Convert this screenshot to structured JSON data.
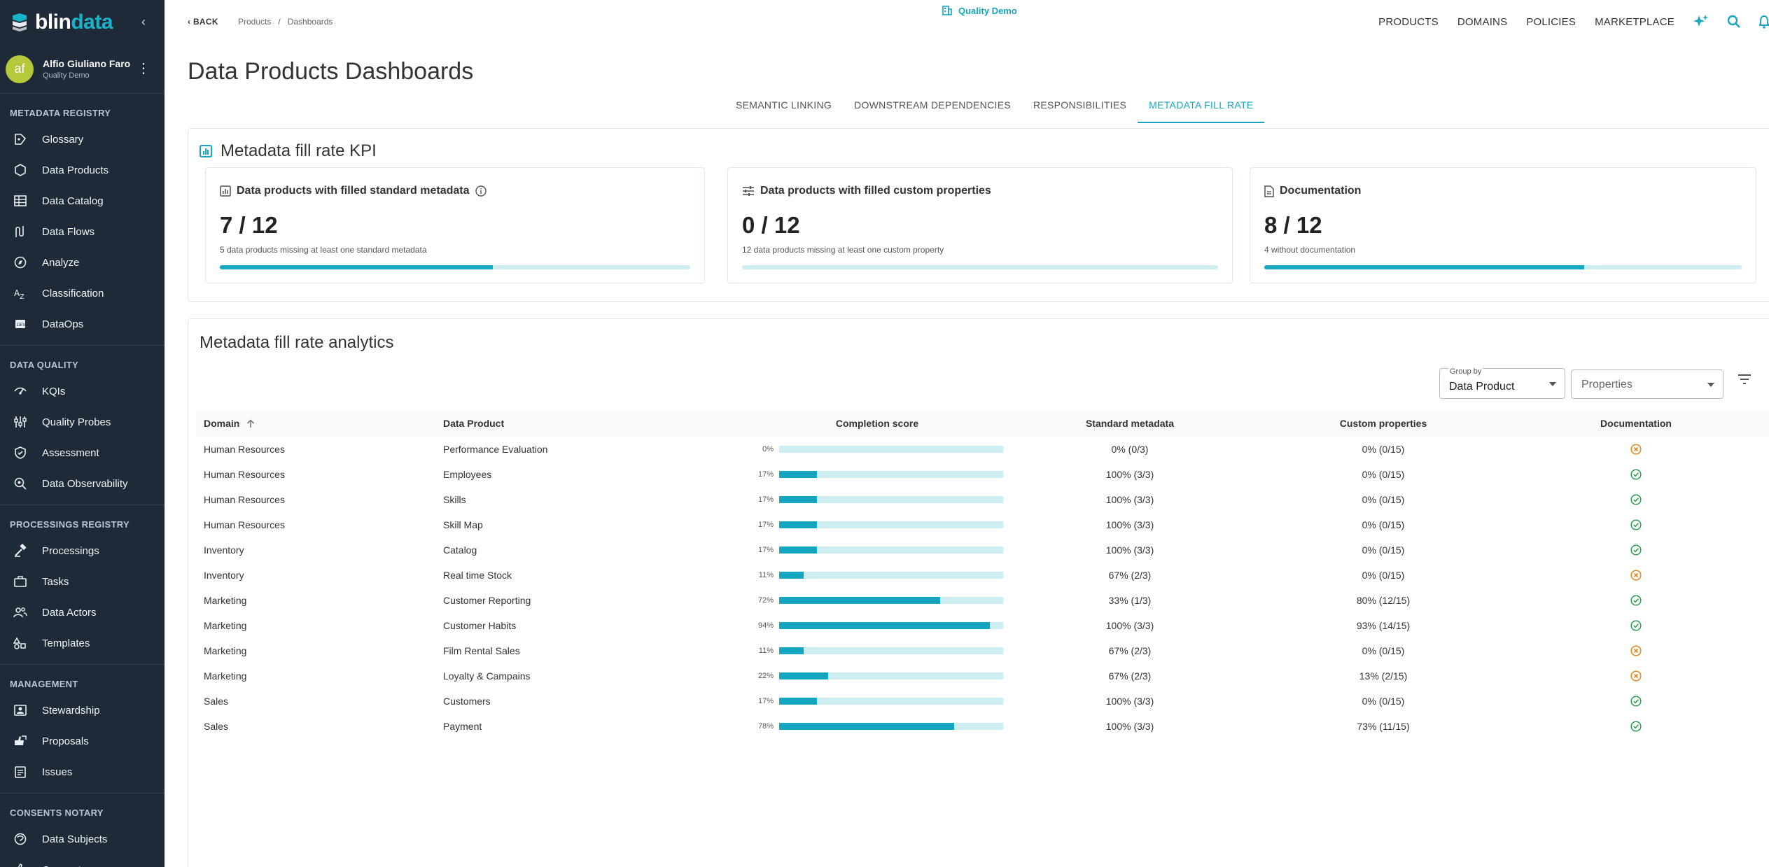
{
  "brand": {
    "logo_text_a": "blin",
    "logo_text_b": "data",
    "accent": "#18a5bd",
    "sidebar_bg": "#1e2a37"
  },
  "user": {
    "initials": "af",
    "name": "Alfio Giuliano Faro",
    "tenant": "Quality Demo"
  },
  "sidebar": {
    "sections": [
      {
        "title": "METADATA REGISTRY",
        "items": [
          {
            "label": "Glossary",
            "icon": "glossary-icon"
          },
          {
            "label": "Data Products",
            "icon": "data-products-icon"
          },
          {
            "label": "Data Catalog",
            "icon": "data-catalog-icon"
          },
          {
            "label": "Data Flows",
            "icon": "data-flows-icon"
          },
          {
            "label": "Analyze",
            "icon": "analyze-icon"
          },
          {
            "label": "Classification",
            "icon": "classification-icon"
          },
          {
            "label": "DataOps",
            "icon": "dataops-icon"
          }
        ]
      },
      {
        "title": "DATA QUALITY",
        "items": [
          {
            "label": "KQIs",
            "icon": "kqis-icon"
          },
          {
            "label": "Quality Probes",
            "icon": "quality-probes-icon"
          },
          {
            "label": "Assessment",
            "icon": "assessment-icon"
          },
          {
            "label": "Data Observability",
            "icon": "data-observability-icon"
          }
        ]
      },
      {
        "title": "PROCESSINGS REGISTRY",
        "items": [
          {
            "label": "Processings",
            "icon": "processings-icon"
          },
          {
            "label": "Tasks",
            "icon": "tasks-icon"
          },
          {
            "label": "Data Actors",
            "icon": "data-actors-icon"
          },
          {
            "label": "Templates",
            "icon": "templates-icon"
          }
        ]
      },
      {
        "title": "MANAGEMENT",
        "items": [
          {
            "label": "Stewardship",
            "icon": "stewardship-icon"
          },
          {
            "label": "Proposals",
            "icon": "proposals-icon"
          },
          {
            "label": "Issues",
            "icon": "issues-icon"
          }
        ]
      },
      {
        "title": "CONSENTS NOTARY",
        "items": [
          {
            "label": "Data Subjects",
            "icon": "data-subjects-icon"
          },
          {
            "label": "Consents",
            "icon": "consents-icon"
          }
        ]
      }
    ]
  },
  "topbar": {
    "back": "BACK",
    "crumb1": "Products",
    "crumb_sep": "/",
    "crumb2": "Dashboards",
    "tenant": "Quality Demo",
    "nav": [
      "PRODUCTS",
      "DOMAINS",
      "POLICIES",
      "MARKETPLACE"
    ]
  },
  "page": {
    "title": "Data Products Dashboards"
  },
  "tabs": [
    "SEMANTIC LINKING",
    "DOWNSTREAM DEPENDENCIES",
    "RESPONSIBILITIES",
    "METADATA FILL RATE"
  ],
  "active_tab": 3,
  "kpi": {
    "title": "Metadata fill rate KPI",
    "cards": [
      {
        "title": "Data products with filled standard metadata",
        "value": "7 / 12",
        "sub": "5 data products missing at least one standard metadata",
        "fill": 0.58
      },
      {
        "title": "Data products with filled custom properties",
        "value": "0 / 12",
        "sub": "12 data products missing at least one custom property",
        "fill": 0
      },
      {
        "title": "Documentation",
        "value": "8 / 12",
        "sub": "4 without documentation",
        "fill": 0.67
      }
    ]
  },
  "analytics": {
    "title": "Metadata fill rate analytics",
    "group_by_label": "Group by",
    "group_by_value": "Data Product",
    "properties_placeholder": "Properties",
    "columns": [
      "Domain",
      "Data Product",
      "Completion score",
      "Standard metadata",
      "Custom properties",
      "Documentation"
    ],
    "rows": [
      {
        "domain": "Human Resources",
        "product": "Performance Evaluation",
        "score": "0%",
        "score_val": 0,
        "standard": "0% (0/3)",
        "custom": "0% (0/15)",
        "doc": false
      },
      {
        "domain": "Human Resources",
        "product": "Employees",
        "score": "17%",
        "score_val": 17,
        "standard": "100% (3/3)",
        "custom": "0% (0/15)",
        "doc": true
      },
      {
        "domain": "Human Resources",
        "product": "Skills",
        "score": "17%",
        "score_val": 17,
        "standard": "100% (3/3)",
        "custom": "0% (0/15)",
        "doc": true
      },
      {
        "domain": "Human Resources",
        "product": "Skill Map",
        "score": "17%",
        "score_val": 17,
        "standard": "100% (3/3)",
        "custom": "0% (0/15)",
        "doc": true
      },
      {
        "domain": "Inventory",
        "product": "Catalog",
        "score": "17%",
        "score_val": 17,
        "standard": "100% (3/3)",
        "custom": "0% (0/15)",
        "doc": true
      },
      {
        "domain": "Inventory",
        "product": "Real time Stock",
        "score": "11%",
        "score_val": 11,
        "standard": "67% (2/3)",
        "custom": "0% (0/15)",
        "doc": false
      },
      {
        "domain": "Marketing",
        "product": "Customer Reporting",
        "score": "72%",
        "score_val": 72,
        "standard": "33% (1/3)",
        "custom": "80% (12/15)",
        "doc": true
      },
      {
        "domain": "Marketing",
        "product": "Customer Habits",
        "score": "94%",
        "score_val": 94,
        "standard": "100% (3/3)",
        "custom": "93% (14/15)",
        "doc": true
      },
      {
        "domain": "Marketing",
        "product": "Film Rental Sales",
        "score": "11%",
        "score_val": 11,
        "standard": "67% (2/3)",
        "custom": "0% (0/15)",
        "doc": false
      },
      {
        "domain": "Marketing",
        "product": "Loyalty & Campains",
        "score": "22%",
        "score_val": 22,
        "standard": "67% (2/3)",
        "custom": "13% (2/15)",
        "doc": false
      },
      {
        "domain": "Sales",
        "product": "Customers",
        "score": "17%",
        "score_val": 17,
        "standard": "100% (3/3)",
        "custom": "0% (0/15)",
        "doc": true
      },
      {
        "domain": "Sales",
        "product": "Payment",
        "score": "78%",
        "score_val": 78,
        "standard": "100% (3/3)",
        "custom": "73% (11/15)",
        "doc": true
      }
    ]
  }
}
